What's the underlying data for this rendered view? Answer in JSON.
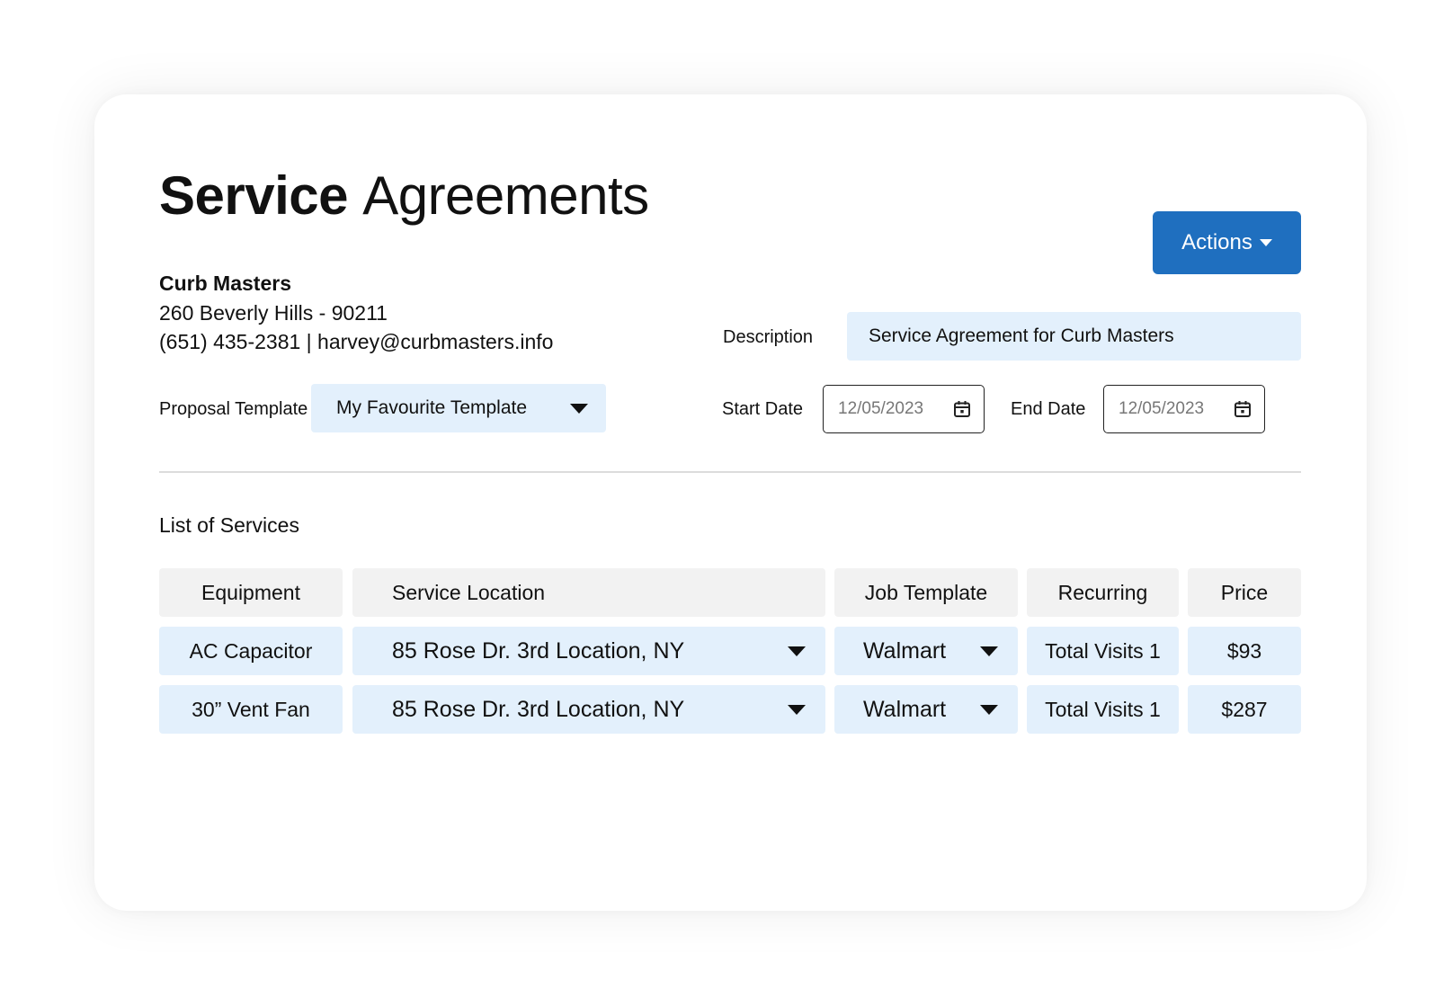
{
  "page": {
    "title_bold": "Service",
    "title_light": "Agreements"
  },
  "actions": {
    "label": "Actions"
  },
  "customer": {
    "name": "Curb Masters",
    "address": "260 Beverly Hills - 90211",
    "contact": "(651) 435-2381 | harvey@curbmasters.info"
  },
  "form": {
    "proposal_template_label": "Proposal Template",
    "proposal_template_value": "My Favourite Template",
    "description_label": "Description",
    "description_value": "Service Agreement for Curb Masters",
    "start_date_label": "Start Date",
    "start_date_value": "12/05/2023",
    "end_date_label": "End Date",
    "end_date_value": "12/05/2023"
  },
  "services": {
    "title": "List of Services",
    "columns": [
      "Equipment",
      "Service Location",
      "Job Template",
      "Recurring",
      "Price"
    ],
    "rows": [
      {
        "equipment": "AC Capacitor",
        "location": "85 Rose Dr. 3rd Location, NY",
        "job_template": "Walmart",
        "recurring": "Total Visits 1",
        "price": "$93"
      },
      {
        "equipment": "30” Vent Fan",
        "location": "85 Rose Dr. 3rd Location, NY",
        "job_template": "Walmart",
        "recurring": "Total Visits 1",
        "price": "$287"
      }
    ]
  },
  "colors": {
    "accent": "#1f6fbf",
    "field_bg": "#e3f0fc",
    "header_bg": "#f2f2f2"
  }
}
